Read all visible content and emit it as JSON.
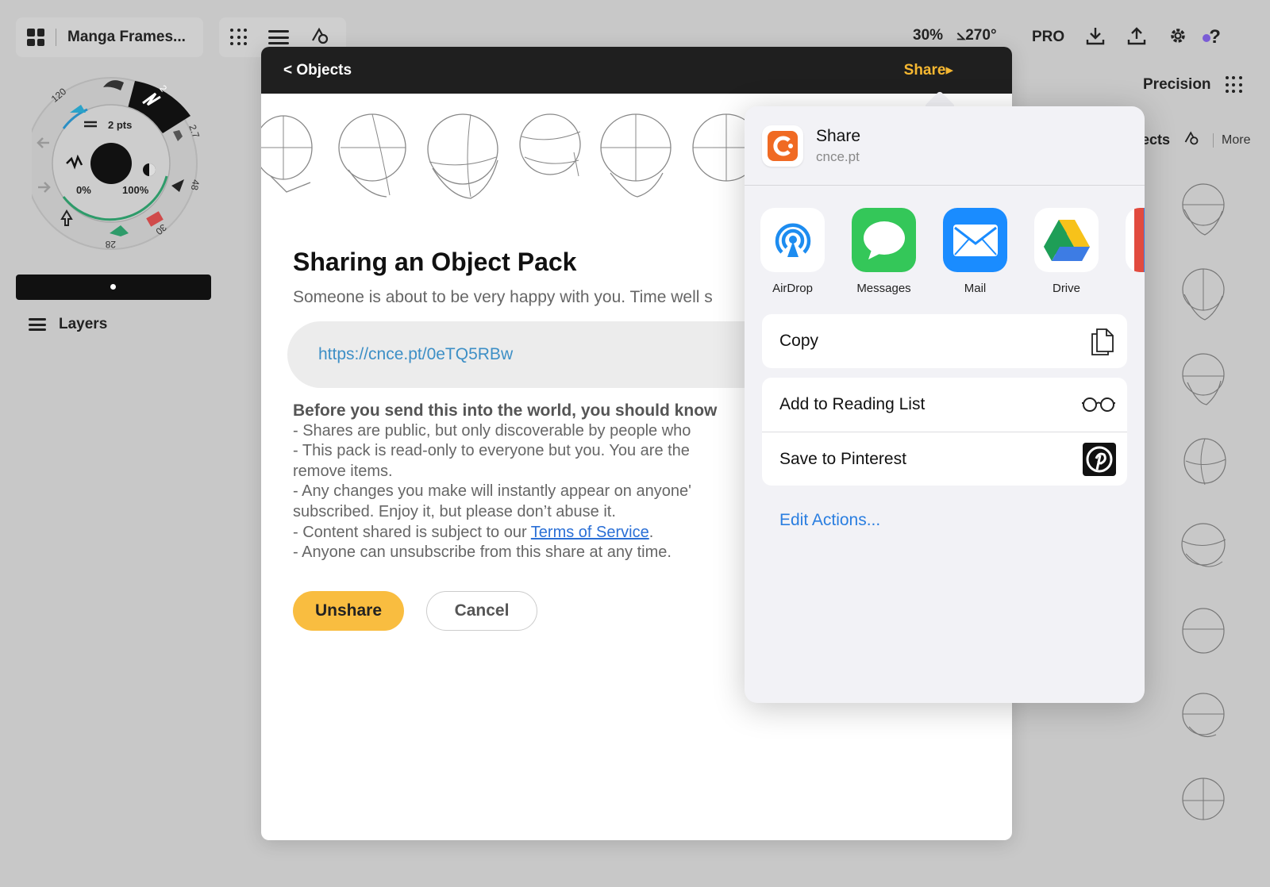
{
  "app": {
    "doc_title": "Manga Frames...",
    "zoom": "30%",
    "rotation": "⦣270°",
    "pro_label": "PRO",
    "precision_label": "Precision",
    "objects_tab": "ects",
    "more_tab": "More",
    "layers_label": "Layers"
  },
  "wheel": {
    "size": "2 pts",
    "opacity_min": "0%",
    "opacity_max": "100%",
    "numbers": [
      "120",
      "2",
      "2.7",
      "48",
      "30",
      "28"
    ]
  },
  "modal": {
    "back_label": "< Objects",
    "share_label": "Share▸",
    "title": "Sharing an Object Pack",
    "subtitle": "Someone is about to be very happy with you. Time well s",
    "url": "https://cnce.pt/0eTQ5RBw",
    "info_heading": "Before you send this into the world, you should know",
    "info_lines": [
      "- Shares are public, but only discoverable by people who",
      "- This pack is read-only to everyone but you. You are the",
      "remove items.",
      "- Any changes you make will instantly appear on anyone'",
      "subscribed. Enjoy it, but please don’t abuse it."
    ],
    "tos_prefix": "- Content shared is subject to our ",
    "tos_link": "Terms of Service",
    "tos_suffix": ".",
    "last_line": "- Anyone can unsubscribe from this share at any time.",
    "unshare_label": "Unshare",
    "cancel_label": "Cancel"
  },
  "share_sheet": {
    "title": "Share",
    "domain": "cnce.pt",
    "apps": [
      {
        "label": "AirDrop",
        "color": "#ffffff"
      },
      {
        "label": "Messages",
        "color": "#34c759"
      },
      {
        "label": "Mail",
        "color": "#1a8cff"
      },
      {
        "label": "Drive",
        "color": "#ffffff"
      }
    ],
    "actions": [
      "Copy",
      "Add to Reading List",
      "Save to Pinterest"
    ],
    "edit_actions": "Edit Actions..."
  }
}
